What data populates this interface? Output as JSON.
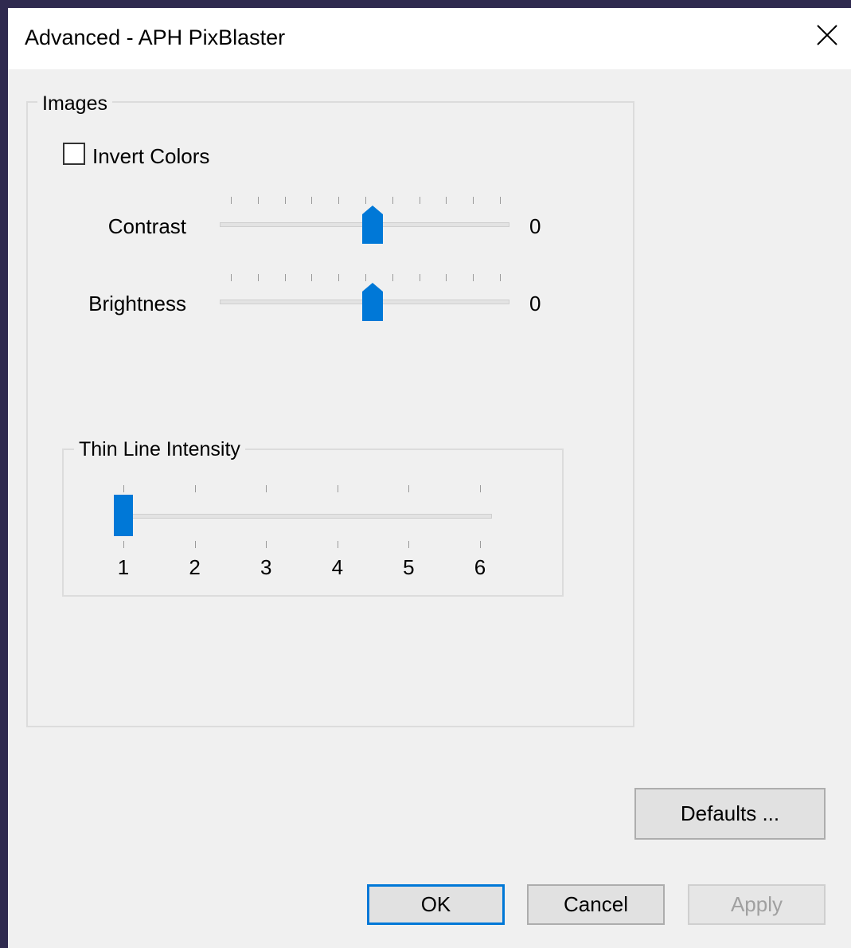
{
  "window": {
    "title": "Advanced - APH PixBlaster"
  },
  "images_group": {
    "legend": "Images",
    "invert_colors": {
      "label": "Invert Colors",
      "checked": false
    },
    "contrast": {
      "label": "Contrast",
      "value": "0"
    },
    "brightness": {
      "label": "Brightness",
      "value": "0"
    }
  },
  "thin_line_group": {
    "legend": "Thin Line Intensity",
    "tick_labels": [
      "1",
      "2",
      "3",
      "4",
      "5",
      "6"
    ],
    "selected": 1
  },
  "buttons": {
    "defaults": "Defaults ...",
    "ok": "OK",
    "cancel": "Cancel",
    "apply": "Apply"
  },
  "colors": {
    "accent": "#0078d7",
    "frame": "#2f2a4f"
  },
  "icons": {
    "close": "close-icon"
  }
}
